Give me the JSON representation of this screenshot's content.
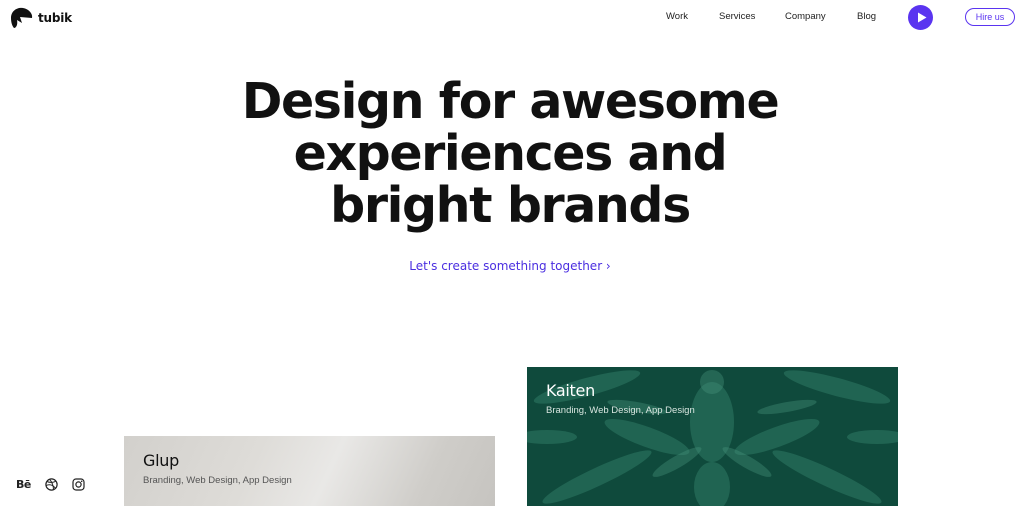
{
  "brand": {
    "name": "tubik"
  },
  "nav": {
    "items": [
      {
        "label": "Work"
      },
      {
        "label": "Services"
      },
      {
        "label": "Company"
      },
      {
        "label": "Blog"
      }
    ],
    "hire_label": "Hire us"
  },
  "hero": {
    "lines": [
      "Design for awesome",
      "experiences and",
      "bright brands"
    ],
    "cta_label": "Let's create something together ›"
  },
  "projects": [
    {
      "title": "Glup",
      "tags": "Branding, Web Design, App Design"
    },
    {
      "title": "Kaiten",
      "tags": "Branding, Web Design, App Design"
    }
  ],
  "social": {
    "behance_label": "Bē"
  },
  "colors": {
    "accent": "#5a34f0",
    "cta": "#4a2ee0",
    "kaiten_bg": "#0f4a3c",
    "text": "#111111"
  },
  "icons": [
    "tubik-logo-icon",
    "play-icon",
    "behance-icon",
    "dribbble-icon",
    "instagram-icon"
  ]
}
